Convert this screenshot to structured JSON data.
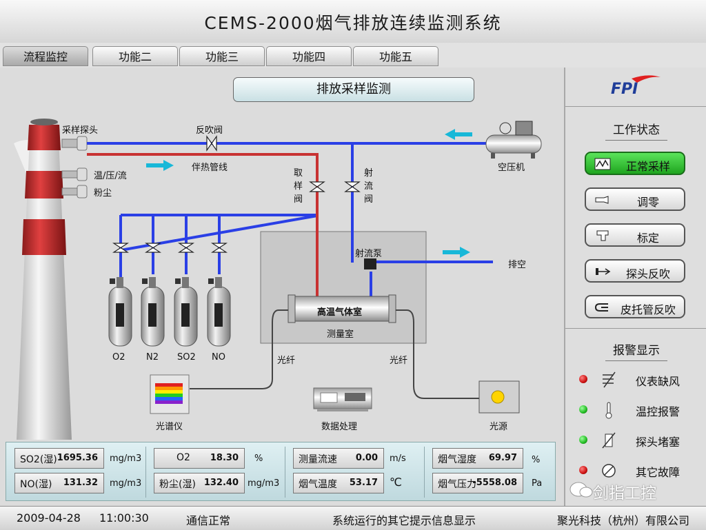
{
  "title": "CEMS-2000烟气排放连续监测系统",
  "tabs": [
    "流程监控",
    "功能二",
    "功能三",
    "功能四",
    "功能五"
  ],
  "diagram": {
    "heading": "排放采样监测",
    "labels": {
      "probe": "采样探头",
      "blowback_valve": "反吹阀",
      "temp_press_flow": "温/压/流",
      "dust": "粉尘",
      "heat_line": "伴热管线",
      "sample_valve": "取\n样\n阀",
      "jet_valve": "射\n流\n阀",
      "compressor": "空压机",
      "jet_pump": "射流泵",
      "exhaust": "排空",
      "cell": "高温气体室",
      "chamber": "测量室",
      "fiber_left": "光纤",
      "fiber_right": "光纤",
      "spectrometer": "光谱仪",
      "data_proc": "数据处理",
      "light_source": "光源"
    },
    "cylinders": [
      "O2",
      "N2",
      "SO2",
      "NO"
    ]
  },
  "readouts": {
    "so2": {
      "name": "SO2(湿)",
      "value": "1695.36",
      "unit": "mg/m3"
    },
    "no": {
      "name": "NO(湿)",
      "value": "131.32",
      "unit": "mg/m3"
    },
    "o2": {
      "name": "O2",
      "value": "18.30",
      "unit": "%"
    },
    "dust": {
      "name": "粉尘(湿)",
      "value": "132.40",
      "unit": "mg/m3"
    },
    "flow": {
      "name": "测量流速",
      "value": "0.00",
      "unit": "m/s"
    },
    "temp": {
      "name": "烟气温度",
      "value": "53.17",
      "unit": "℃"
    },
    "humidity": {
      "name": "烟气湿度",
      "value": "69.97",
      "unit": "%"
    },
    "pressure": {
      "name": "烟气压力",
      "value": "-5558.08",
      "unit": "Pa"
    }
  },
  "panel": {
    "logo": "FPI",
    "work_status_title": "工作状态",
    "buttons": [
      "正常采样",
      "调零",
      "标定",
      "探头反吹",
      "皮托管反吹"
    ],
    "alarm_title": "报警显示",
    "alarms": [
      {
        "label": "仪表缺风",
        "color": "#cc1111"
      },
      {
        "label": "温控报警",
        "color": "#22bb22"
      },
      {
        "label": "探头堵塞",
        "color": "#22bb22"
      },
      {
        "label": "其它故障",
        "color": "#cc1111"
      }
    ],
    "watermark": "剑指工控"
  },
  "status": {
    "date": "2009-04-28",
    "time": "11:00:30",
    "comm": "通信正常",
    "message": "系统运行的其它提示信息显示",
    "company": "聚光科技（杭州）有限公司"
  },
  "colors": {
    "red_pipe": "#c83232",
    "blue_pipe": "#2a3fe6",
    "arrow": "#18b8d8",
    "active_button": "#2fbf2f"
  }
}
